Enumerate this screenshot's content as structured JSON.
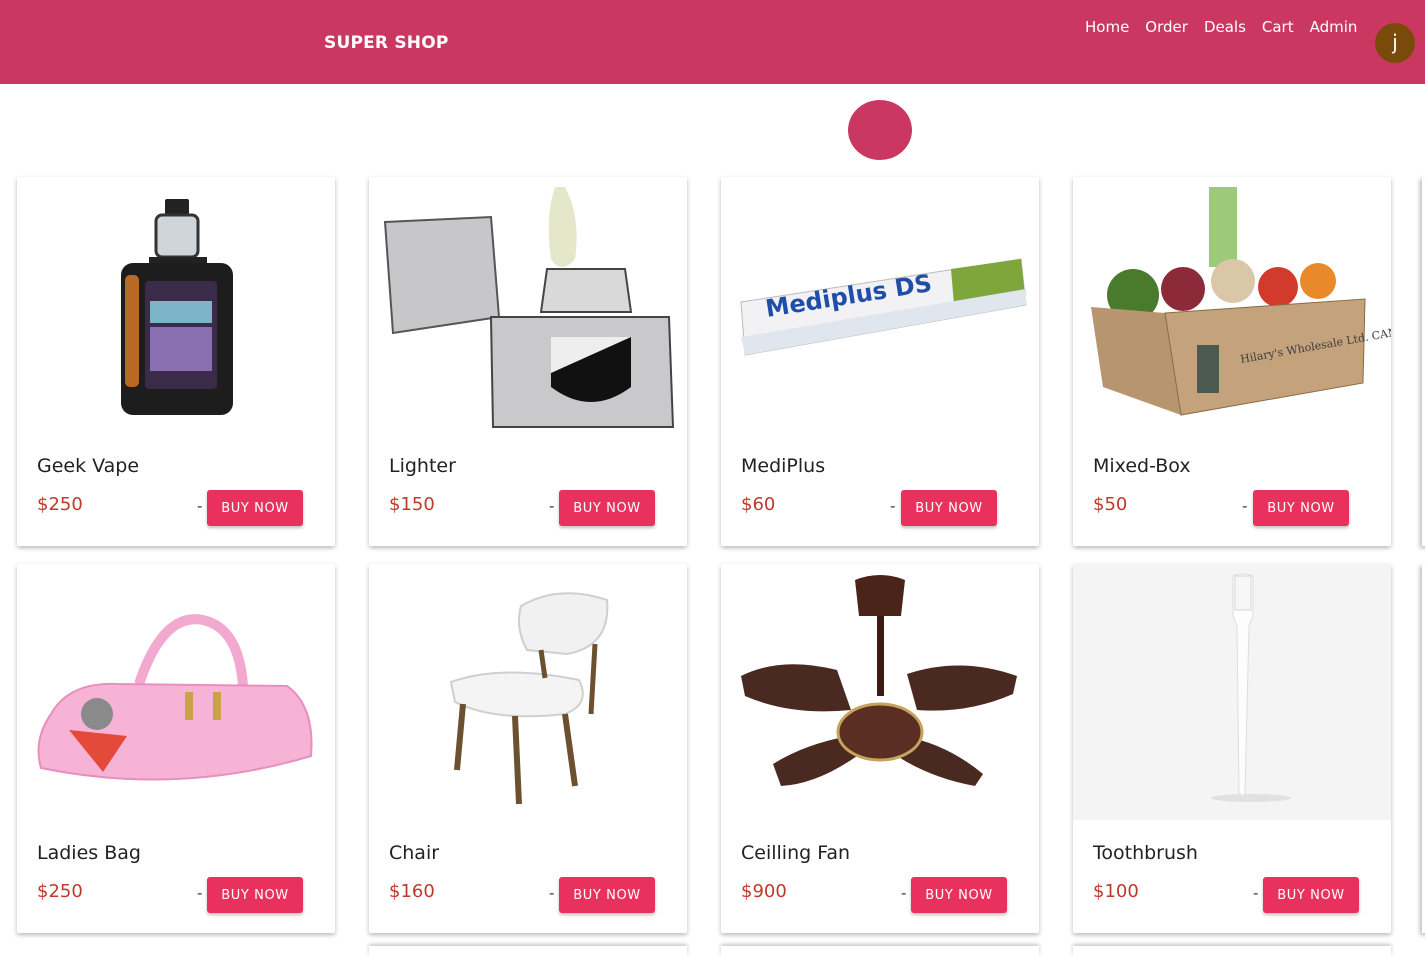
{
  "brand": "SUPER SHOP",
  "nav": [
    "Home",
    "Order",
    "Deals",
    "Cart",
    "Admin"
  ],
  "user_initial": "j",
  "colors": {
    "navbar": "#ca3862",
    "buy_button": "#e8315c",
    "price": "#c0392b"
  },
  "buy_label": "BUY NOW",
  "dash": "-",
  "products": [
    {
      "name": "Geek Vape",
      "price": "$250",
      "icon": "vape-device-image"
    },
    {
      "name": "Lighter",
      "price": "$150",
      "icon": "lighter-image"
    },
    {
      "name": "MediPlus",
      "price": "$60",
      "icon": "toothpaste-image",
      "package_text": "Mediplus DS"
    },
    {
      "name": "Mixed-Box",
      "price": "$50",
      "icon": "vegetable-box-image",
      "package_text": "Hilary's Wholesale Ltd. CAMBRIDGE"
    },
    {
      "name": "Ladies Bag",
      "price": "$250",
      "icon": "handbag-image"
    },
    {
      "name": "Chair",
      "price": "$160",
      "icon": "chair-image"
    },
    {
      "name": "Ceilling Fan",
      "price": "$900",
      "icon": "ceiling-fan-image"
    },
    {
      "name": "Toothbrush",
      "price": "$100",
      "icon": "toothbrush-image"
    }
  ]
}
